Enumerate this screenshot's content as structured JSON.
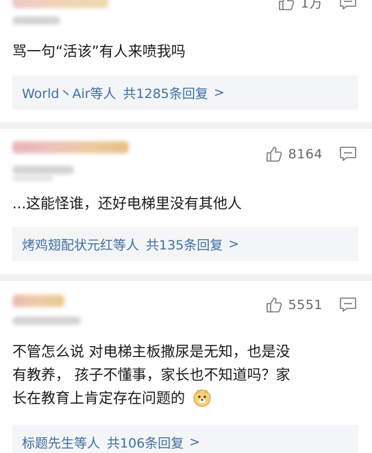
{
  "comments": [
    {
      "like_count": "1万",
      "text": "骂一句“活该”有人来喷我吗",
      "reply": {
        "users": "World丶Air等人",
        "count": "共1285条回复",
        "arrow": ">"
      }
    },
    {
      "like_count": "8164",
      "text": "...这能怪谁，还好电梯里没有其他人",
      "reply": {
        "users": "烤鸡翅配状元红等人",
        "count": "共135条回复",
        "arrow": ">"
      }
    },
    {
      "like_count": "5551",
      "text_lines": [
        "不管怎么说 对电梯主板撒尿是无知，也是没",
        "有教养， 孩子不懂事，家长也不知道吗？家",
        "长在教育上肯定存在问题的"
      ],
      "emoji": "doge-emoji",
      "reply": {
        "users": "标题先生等人",
        "count": "共106条回复",
        "arrow": ">"
      }
    }
  ],
  "icons": {
    "like": "thumbs-up-icon",
    "reply": "comment-icon"
  },
  "colors": {
    "link": "#3f6fa3",
    "reply_bg": "#f4f5f7",
    "separator": "#f2f2f2",
    "muted": "#666666"
  }
}
